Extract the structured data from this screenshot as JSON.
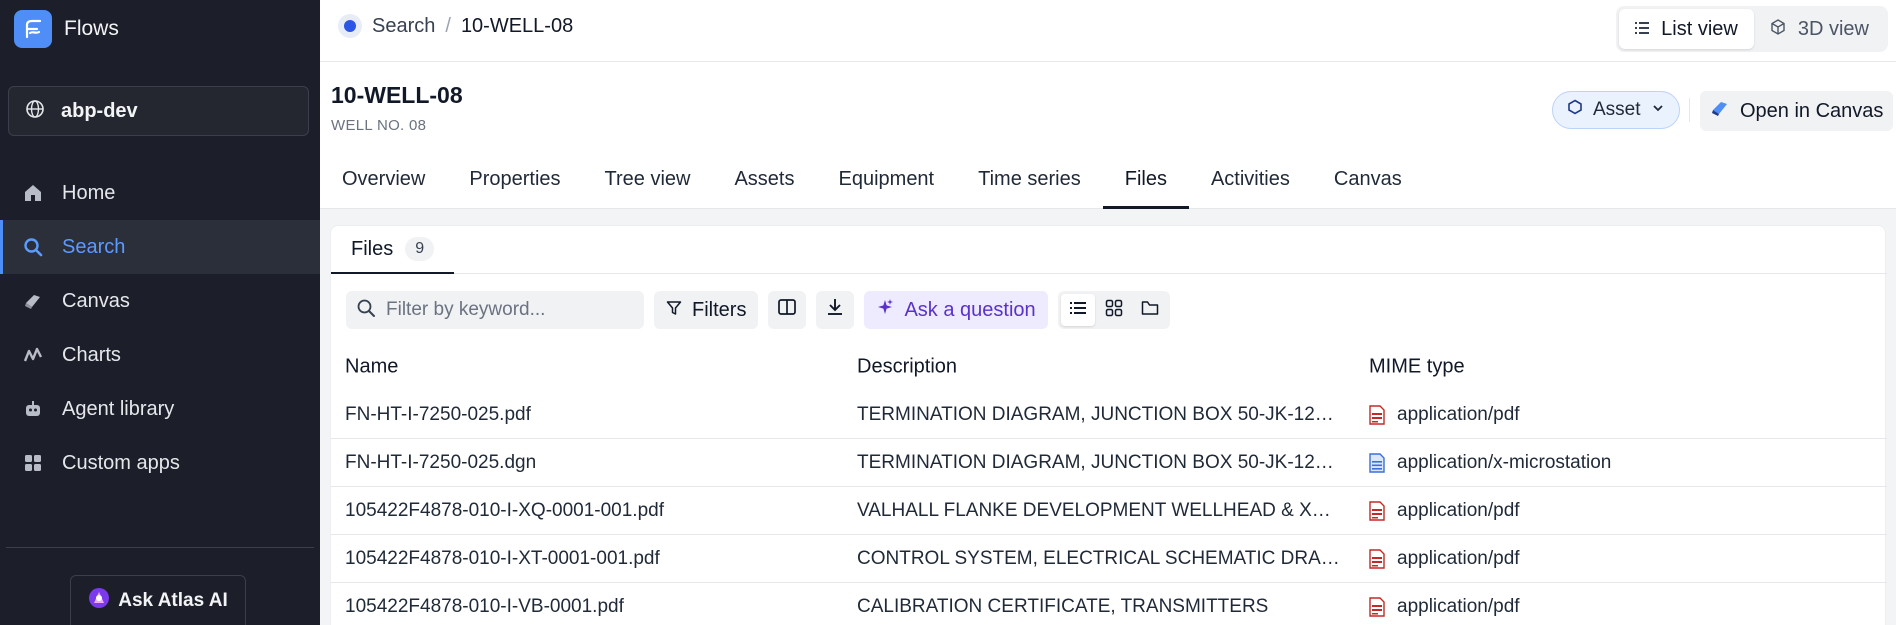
{
  "app": {
    "name": "Flows",
    "project": "abp-dev"
  },
  "sidebar": {
    "items": [
      {
        "label": "Home",
        "icon": "home-icon"
      },
      {
        "label": "Search",
        "icon": "search-icon",
        "active": true
      },
      {
        "label": "Canvas",
        "icon": "canvas-icon"
      },
      {
        "label": "Charts",
        "icon": "charts-icon"
      },
      {
        "label": "Agent library",
        "icon": "agent-icon"
      },
      {
        "label": "Custom apps",
        "icon": "apps-icon"
      }
    ],
    "atlas_label": "Ask Atlas AI"
  },
  "breadcrumb": {
    "root": "Search",
    "separator": "/",
    "current": "10-WELL-08"
  },
  "view_toggle": {
    "list": "List view",
    "threed": "3D view"
  },
  "header": {
    "title": "10-WELL-08",
    "subtitle": "WELL NO. 08",
    "badge": "Asset",
    "open_canvas": "Open in Canvas"
  },
  "tabs": [
    "Overview",
    "Properties",
    "Tree view",
    "Assets",
    "Equipment",
    "Time series",
    "Files",
    "Activities",
    "Canvas"
  ],
  "active_tab": "Files",
  "files_tab": {
    "label": "Files",
    "count": "9"
  },
  "toolbar": {
    "search_placeholder": "Filter by keyword...",
    "filters_label": "Filters",
    "ask_label": "Ask a question"
  },
  "table": {
    "columns": [
      "Name",
      "Description",
      "MIME type"
    ],
    "rows": [
      {
        "name": "FN-HT-I-7250-025.pdf",
        "description": "TERMINATION DIAGRAM, JUNCTION BOX 50-JK-12…",
        "mime": "application/pdf",
        "kind": "pdf"
      },
      {
        "name": "FN-HT-I-7250-025.dgn",
        "description": "TERMINATION DIAGRAM, JUNCTION BOX 50-JK-12…",
        "mime": "application/x-microstation",
        "kind": "doc"
      },
      {
        "name": "105422F4878-010-I-XQ-0001-001.pdf",
        "description": "VALHALL FLANKE DEVELOPMENT WELLHEAD & XM…",
        "mime": "application/pdf",
        "kind": "pdf"
      },
      {
        "name": "105422F4878-010-I-XT-0001-001.pdf",
        "description": "CONTROL SYSTEM, ELECTRICAL SCHEMATIC DRA…",
        "mime": "application/pdf",
        "kind": "pdf"
      },
      {
        "name": "105422F4878-010-I-VB-0001.pdf",
        "description": "CALIBRATION CERTIFICATE, TRANSMITTERS",
        "mime": "application/pdf",
        "kind": "pdf"
      }
    ]
  },
  "colors": {
    "accent": "#4f8df7",
    "sidebar_bg": "#1c1f2a",
    "ask_purple": "#5a32c8",
    "pdf_red": "#c62828",
    "doc_blue": "#3b6fd8"
  }
}
